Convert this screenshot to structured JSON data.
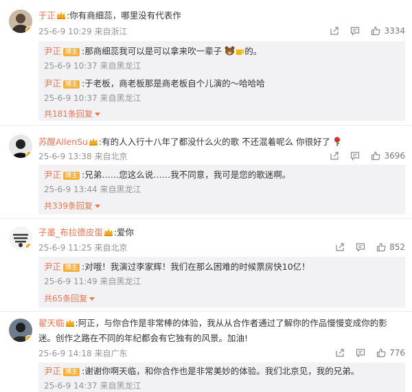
{
  "threads": [
    {
      "user": "于正",
      "text": ":你有商细蕊，哪里没有代表作",
      "time": "25-6-9 10:29",
      "location": "来自浙江",
      "likes": "3334",
      "replies": [
        {
          "user": "尹正",
          "badge": "博主",
          "text_a": ":那商细蕊我可以是可以拿来吹一辈子",
          "text_b": "的。",
          "time": "25-6-9 10:37",
          "location": "来自黑龙江"
        },
        {
          "user": "尹正",
          "badge": "博主",
          "text_a": ":于老板，商老板那是商老板自个儿演的～哈哈哈",
          "text_b": "",
          "time": "25-6-9 10:37",
          "location": "来自黑龙江"
        }
      ],
      "more": "共181条回复"
    },
    {
      "user": "苏醒AllenSu",
      "text": ":有的人入行十八年了都没什么火的歌 不还混着呢么 你很好了",
      "time": "25-6-9 13:38",
      "location": "来自北京",
      "likes": "3696",
      "replies": [
        {
          "user": "尹正",
          "badge": "博主",
          "text_a": ":兄弟……您这么说……我不同意，我可是您的歌迷啊。",
          "text_b": "",
          "time": "25-6-9 13:44",
          "location": "来自黑龙江"
        }
      ],
      "more": "共339条回复"
    },
    {
      "user": "子墨_布拉德皮蛋",
      "text": ":爱你",
      "time": "25-6-9 11:25",
      "location": "来自北京",
      "likes": "852",
      "replies": [
        {
          "user": "尹正",
          "badge": "博主",
          "text_a": ":对哦！我演过李家辉！我们在那么困难的时候票房快10亿！",
          "text_b": "",
          "time": "25-6-9 11:49",
          "location": "来自黑龙江"
        }
      ],
      "more": "共65条回复"
    },
    {
      "user": "翟天临",
      "text_line1": ":阿正，与你合作是非常棒的体验，我从从合作者通过了解你的作品慢慢变成你的影",
      "text_line2": "迷。创作之路在不同的年纪都会有它独有的风景。加油!",
      "time": "25-6-9 14:18",
      "location": "来自广东",
      "likes": "776",
      "replies": [
        {
          "user": "尹正",
          "badge": "博主",
          "text_a": ":谢谢你啊天临，和你合作也是非常美妙的体验。我们北京见，我的兄弟。",
          "text_b": "",
          "time": "25-6-9 14:37",
          "location": "来自黑龙江"
        }
      ]
    }
  ],
  "colors": {
    "username": "#eb7350",
    "badge": "#f7b23d",
    "reply_bg": "#f2f2f5",
    "meta": "#939393"
  },
  "icons": [
    "share-icon",
    "comment-icon",
    "like-icon",
    "crown-icon",
    "bear-emoji-icon",
    "beer-emoji-icon",
    "rose-emoji-icon"
  ]
}
